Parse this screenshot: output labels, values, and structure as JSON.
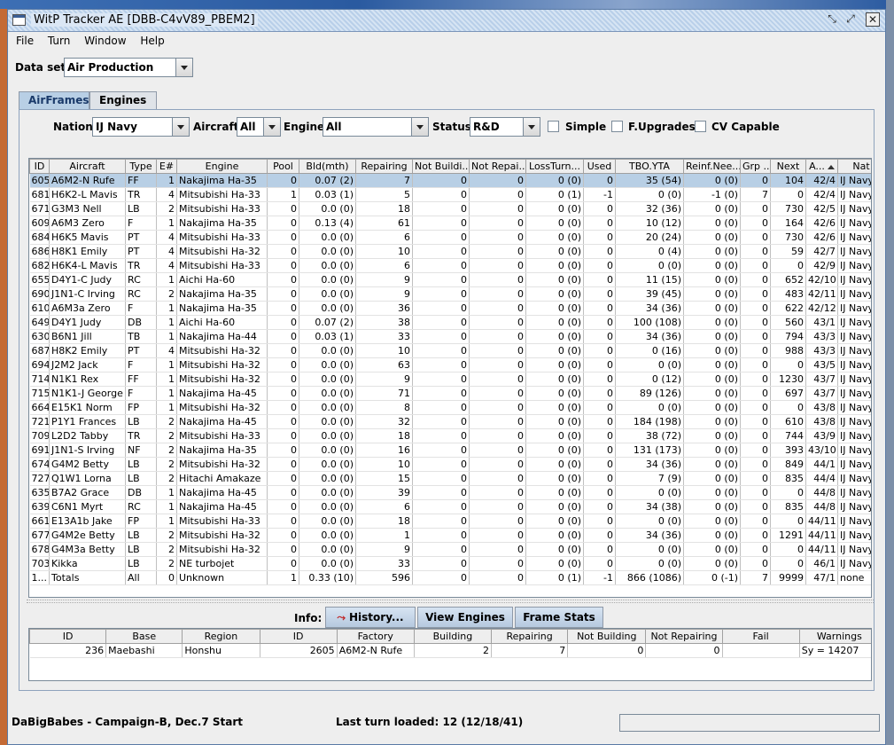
{
  "window": {
    "title": "WitP Tracker AE [DBB-C4vV89_PBEM2]"
  },
  "menu": [
    "File",
    "Turn",
    "Window",
    "Help"
  ],
  "dataset": {
    "label": "Data set:",
    "value": "Air Production"
  },
  "tabs": [
    "AirFrames",
    "Engines"
  ],
  "filters": {
    "nation_label": "Nation:",
    "nation": "IJ Navy",
    "aircraft_label": "Aircraft:",
    "aircraft": "All",
    "engine_label": "Engine:",
    "engine": "All",
    "status_label": "Status:",
    "status": "R&D",
    "simple": "Simple",
    "fupgrades": "F.Upgrades",
    "cv": "CV Capable"
  },
  "columns": [
    "ID",
    "Aircraft",
    "Type",
    "E#",
    "Engine",
    "Pool",
    "Bld(mth)",
    "Repairing",
    "Not Buildi...",
    "Not Repai...",
    "LossTurn...",
    "Used",
    "TBO.YTA",
    "Reinf.Nee...",
    "Grp ...",
    "Next",
    "A...",
    "Nat"
  ],
  "rows": [
    [
      "605",
      "A6M2-N Rufe",
      "FF",
      "1",
      "Nakajima Ha-35",
      "0",
      "0.07 (2)",
      "7",
      "0",
      "0",
      "0 (0)",
      "0",
      "35 (54)",
      "0 (0)",
      "0",
      "104",
      "42/4",
      "IJ Navy"
    ],
    [
      "681",
      "H6K2-L Mavis",
      "TR",
      "4",
      "Mitsubishi Ha-33",
      "1",
      "0.03 (1)",
      "5",
      "0",
      "0",
      "0 (1)",
      "-1",
      "0 (0)",
      "-1 (0)",
      "7",
      "0",
      "42/4",
      "IJ Navy"
    ],
    [
      "671",
      "G3M3 Nell",
      "LB",
      "2",
      "Mitsubishi Ha-33",
      "0",
      "0.0 (0)",
      "18",
      "0",
      "0",
      "0 (0)",
      "0",
      "32 (36)",
      "0 (0)",
      "0",
      "730",
      "42/5",
      "IJ Navy"
    ],
    [
      "609",
      "A6M3 Zero",
      "F",
      "1",
      "Nakajima Ha-35",
      "0",
      "0.13 (4)",
      "61",
      "0",
      "0",
      "0 (0)",
      "0",
      "10 (12)",
      "0 (0)",
      "0",
      "164",
      "42/6",
      "IJ Navy"
    ],
    [
      "684",
      "H6K5 Mavis",
      "PT",
      "4",
      "Mitsubishi Ha-33",
      "0",
      "0.0 (0)",
      "6",
      "0",
      "0",
      "0 (0)",
      "0",
      "20 (24)",
      "0 (0)",
      "0",
      "730",
      "42/6",
      "IJ Navy"
    ],
    [
      "686",
      "H8K1 Emily",
      "PT",
      "4",
      "Mitsubishi Ha-32",
      "0",
      "0.0 (0)",
      "10",
      "0",
      "0",
      "0 (0)",
      "0",
      "0 (4)",
      "0 (0)",
      "0",
      "59",
      "42/7",
      "IJ Navy"
    ],
    [
      "682",
      "H6K4-L Mavis",
      "TR",
      "4",
      "Mitsubishi Ha-33",
      "0",
      "0.0 (0)",
      "6",
      "0",
      "0",
      "0 (0)",
      "0",
      "0 (0)",
      "0 (0)",
      "0",
      "0",
      "42/9",
      "IJ Navy"
    ],
    [
      "655",
      "D4Y1-C Judy",
      "RC",
      "1",
      "Aichi Ha-60",
      "0",
      "0.0 (0)",
      "9",
      "0",
      "0",
      "0 (0)",
      "0",
      "11 (15)",
      "0 (0)",
      "0",
      "652",
      "42/10",
      "IJ Navy"
    ],
    [
      "690",
      "J1N1-C Irving",
      "RC",
      "2",
      "Nakajima Ha-35",
      "0",
      "0.0 (0)",
      "9",
      "0",
      "0",
      "0 (0)",
      "0",
      "39 (45)",
      "0 (0)",
      "0",
      "483",
      "42/11",
      "IJ Navy"
    ],
    [
      "610",
      "A6M3a Zero",
      "F",
      "1",
      "Nakajima Ha-35",
      "0",
      "0.0 (0)",
      "36",
      "0",
      "0",
      "0 (0)",
      "0",
      "34 (36)",
      "0 (0)",
      "0",
      "622",
      "42/12",
      "IJ Navy"
    ],
    [
      "649",
      "D4Y1 Judy",
      "DB",
      "1",
      "Aichi Ha-60",
      "0",
      "0.07 (2)",
      "38",
      "0",
      "0",
      "0 (0)",
      "0",
      "100 (108)",
      "0 (0)",
      "0",
      "560",
      "43/1",
      "IJ Navy"
    ],
    [
      "630",
      "B6N1 Jill",
      "TB",
      "1",
      "Nakajima Ha-44",
      "0",
      "0.03 (1)",
      "33",
      "0",
      "0",
      "0 (0)",
      "0",
      "34 (36)",
      "0 (0)",
      "0",
      "794",
      "43/3",
      "IJ Navy"
    ],
    [
      "687",
      "H8K2 Emily",
      "PT",
      "4",
      "Mitsubishi Ha-32",
      "0",
      "0.0 (0)",
      "10",
      "0",
      "0",
      "0 (0)",
      "0",
      "0 (16)",
      "0 (0)",
      "0",
      "988",
      "43/3",
      "IJ Navy"
    ],
    [
      "694",
      "J2M2 Jack",
      "F",
      "1",
      "Mitsubishi Ha-32",
      "0",
      "0.0 (0)",
      "63",
      "0",
      "0",
      "0 (0)",
      "0",
      "0 (0)",
      "0 (0)",
      "0",
      "0",
      "43/5",
      "IJ Navy"
    ],
    [
      "714",
      "N1K1 Rex",
      "FF",
      "1",
      "Mitsubishi Ha-32",
      "0",
      "0.0 (0)",
      "9",
      "0",
      "0",
      "0 (0)",
      "0",
      "0 (12)",
      "0 (0)",
      "0",
      "1230",
      "43/7",
      "IJ Navy"
    ],
    [
      "715",
      "N1K1-J George",
      "F",
      "1",
      "Nakajima Ha-45",
      "0",
      "0.0 (0)",
      "71",
      "0",
      "0",
      "0 (0)",
      "0",
      "89 (126)",
      "0 (0)",
      "0",
      "697",
      "43/7",
      "IJ Navy"
    ],
    [
      "664",
      "E15K1 Norm",
      "FP",
      "1",
      "Mitsubishi Ha-32",
      "0",
      "0.0 (0)",
      "8",
      "0",
      "0",
      "0 (0)",
      "0",
      "0 (0)",
      "0 (0)",
      "0",
      "0",
      "43/8",
      "IJ Navy"
    ],
    [
      "721",
      "P1Y1 Frances",
      "LB",
      "2",
      "Nakajima Ha-45",
      "0",
      "0.0 (0)",
      "32",
      "0",
      "0",
      "0 (0)",
      "0",
      "184 (198)",
      "0 (0)",
      "0",
      "610",
      "43/8",
      "IJ Navy"
    ],
    [
      "709",
      "L2D2 Tabby",
      "TR",
      "2",
      "Mitsubishi Ha-33",
      "0",
      "0.0 (0)",
      "18",
      "0",
      "0",
      "0 (0)",
      "0",
      "38 (72)",
      "0 (0)",
      "0",
      "744",
      "43/9",
      "IJ Navy"
    ],
    [
      "691",
      "J1N1-S Irving",
      "NF",
      "2",
      "Nakajima Ha-35",
      "0",
      "0.0 (0)",
      "16",
      "0",
      "0",
      "0 (0)",
      "0",
      "131 (173)",
      "0 (0)",
      "0",
      "393",
      "43/10",
      "IJ Navy"
    ],
    [
      "674",
      "G4M2 Betty",
      "LB",
      "2",
      "Mitsubishi Ha-32",
      "0",
      "0.0 (0)",
      "10",
      "0",
      "0",
      "0 (0)",
      "0",
      "34 (36)",
      "0 (0)",
      "0",
      "849",
      "44/1",
      "IJ Navy"
    ],
    [
      "727",
      "Q1W1 Lorna",
      "LB",
      "2",
      "Hitachi Amakaze",
      "0",
      "0.0 (0)",
      "15",
      "0",
      "0",
      "0 (0)",
      "0",
      "7 (9)",
      "0 (0)",
      "0",
      "835",
      "44/4",
      "IJ Navy"
    ],
    [
      "635",
      "B7A2 Grace",
      "DB",
      "1",
      "Nakajima Ha-45",
      "0",
      "0.0 (0)",
      "39",
      "0",
      "0",
      "0 (0)",
      "0",
      "0 (0)",
      "0 (0)",
      "0",
      "0",
      "44/8",
      "IJ Navy"
    ],
    [
      "639",
      "C6N1 Myrt",
      "RC",
      "1",
      "Nakajima Ha-45",
      "0",
      "0.0 (0)",
      "6",
      "0",
      "0",
      "0 (0)",
      "0",
      "34 (38)",
      "0 (0)",
      "0",
      "835",
      "44/8",
      "IJ Navy"
    ],
    [
      "661",
      "E13A1b Jake",
      "FP",
      "1",
      "Mitsubishi Ha-33",
      "0",
      "0.0 (0)",
      "18",
      "0",
      "0",
      "0 (0)",
      "0",
      "0 (0)",
      "0 (0)",
      "0",
      "0",
      "44/11",
      "IJ Navy"
    ],
    [
      "677",
      "G4M2e Betty",
      "LB",
      "2",
      "Mitsubishi Ha-32",
      "0",
      "0.0 (0)",
      "1",
      "0",
      "0",
      "0 (0)",
      "0",
      "34 (36)",
      "0 (0)",
      "0",
      "1291",
      "44/11",
      "IJ Navy"
    ],
    [
      "678",
      "G4M3a Betty",
      "LB",
      "2",
      "Mitsubishi Ha-32",
      "0",
      "0.0 (0)",
      "9",
      "0",
      "0",
      "0 (0)",
      "0",
      "0 (0)",
      "0 (0)",
      "0",
      "0",
      "44/11",
      "IJ Navy"
    ],
    [
      "703",
      "Kikka",
      "LB",
      "2",
      "NE turbojet",
      "0",
      "0.0 (0)",
      "33",
      "0",
      "0",
      "0 (0)",
      "0",
      "0 (0)",
      "0 (0)",
      "0",
      "0",
      "46/1",
      "IJ Navy"
    ],
    [
      "1...",
      "Totals",
      "All",
      "0",
      "Unknown",
      "1",
      "0.33 (10)",
      "596",
      "0",
      "0",
      "0 (1)",
      "-1",
      "866 (1086)",
      "0 (-1)",
      "7",
      "9999",
      "47/1",
      "none"
    ]
  ],
  "info": {
    "label": "Info:",
    "history": "History...",
    "view_engines": "View Engines",
    "frame_stats": "Frame Stats"
  },
  "detail_columns": [
    "ID",
    "Base",
    "Region",
    "ID",
    "Factory",
    "Building",
    "Repairing",
    "Not Building",
    "Not Repairing",
    "Fail",
    "Warnings"
  ],
  "detail_rows": [
    [
      "236",
      "Maebashi",
      "Honshu",
      "2605",
      "A6M2-N Rufe",
      "2",
      "7",
      "0",
      "0",
      "",
      "Sy = 14207"
    ]
  ],
  "statusbar": {
    "left": "DaBigBabes - Campaign-B, Dec.7 Start",
    "mid": "Last turn loaded: 12 (12/18/41)"
  }
}
